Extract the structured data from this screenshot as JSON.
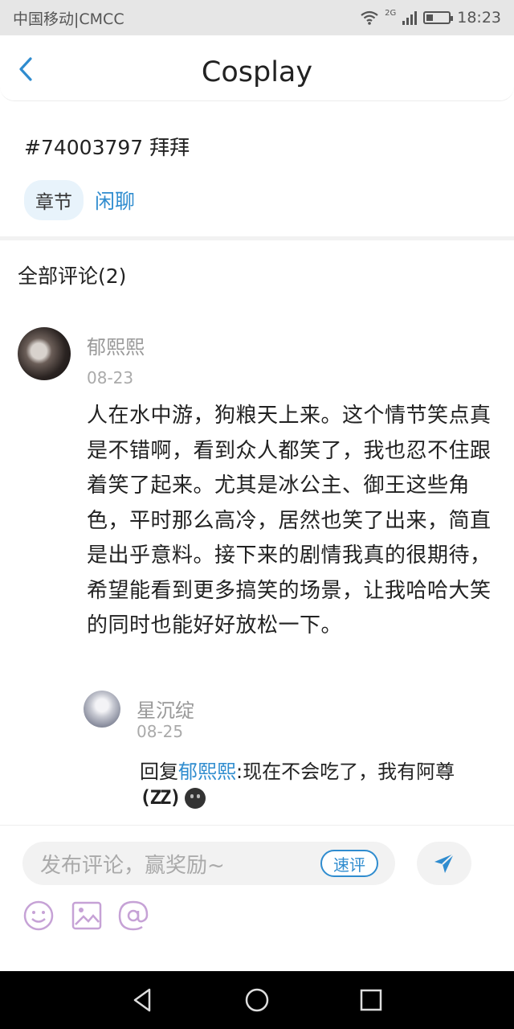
{
  "status_bar": {
    "carrier": "中国移动|CMCC",
    "network": "2G",
    "time": "18:23"
  },
  "header": {
    "title": "Cosplay"
  },
  "post": {
    "title": "#74003797 拜拜",
    "tag_chip": "章节",
    "tag_link": "闲聊"
  },
  "comments": {
    "heading": "全部评论(2)",
    "main": {
      "author": "郁熙熙",
      "date": "08-23",
      "text": "人在水中游，狗粮天上来。这个情节笑点真是不错啊，看到众人都笑了，我也忍不住跟着笑了起来。尤其是冰公主、御王这些角色，平时那么高冷，居然也笑了出来，简直是出乎意料。接下来的剧情我真的很期待，希望能看到更多搞笑的场景，让我哈哈大笑的同时也能好好放松一下。"
    },
    "reply": {
      "author": "星沉绽",
      "date": "08-25",
      "prefix": "回复",
      "reply_to": "郁熙熙",
      "separator": ":",
      "text": "现在不会吃了，我有阿尊",
      "emoji_text": "(ZZ)"
    }
  },
  "comment_bar": {
    "input_placeholder": "发布评论，赢奖励~",
    "quick_label": "速评",
    "accent_color": "#2f8ccf"
  }
}
